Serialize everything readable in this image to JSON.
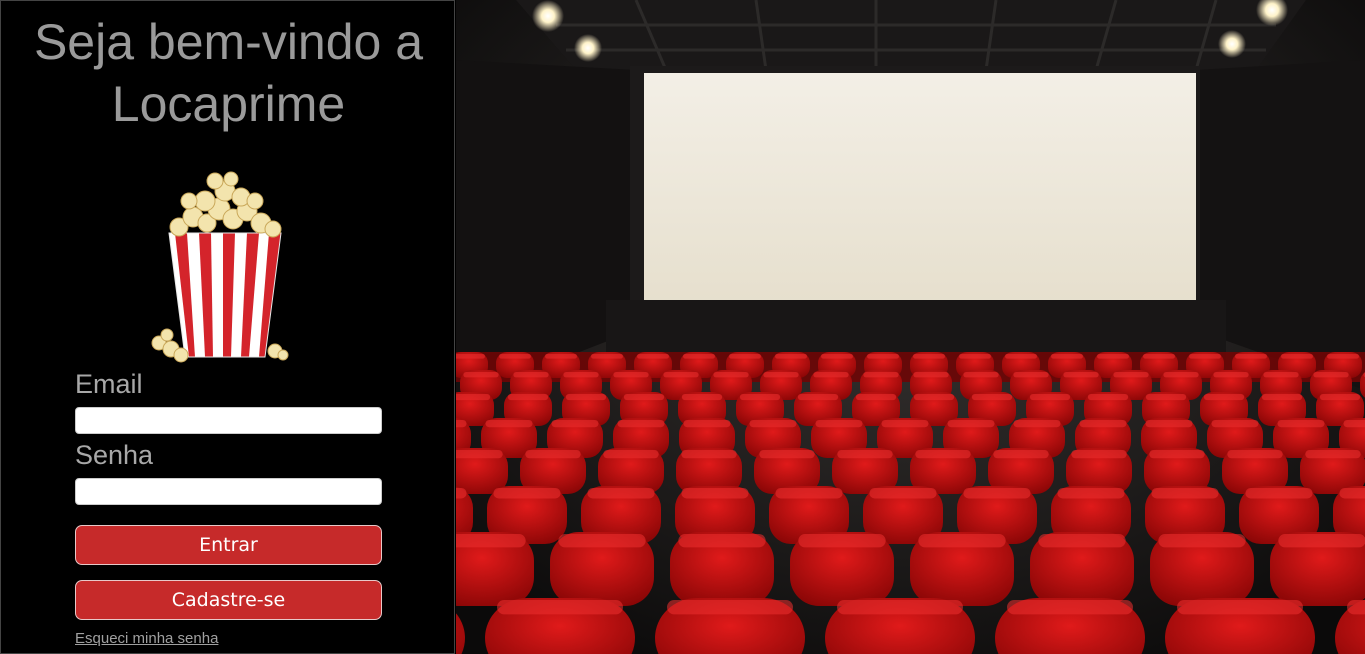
{
  "welcome": {
    "line1": "Seja bem-vindo a",
    "line2": "Locaprime"
  },
  "login": {
    "email_label": "Email",
    "email_value": "",
    "password_label": "Senha",
    "password_value": "",
    "enter_button": "Entrar",
    "signup_button": "Cadastre-se",
    "forgot_link": "Esqueci minha senha"
  },
  "colors": {
    "background": "#000000",
    "button": "#c62a2a",
    "text": "#9a9a9a",
    "seat": "#b80f10"
  },
  "icons": {
    "logo": "popcorn-icon",
    "hero": "cinema-theater-image"
  }
}
